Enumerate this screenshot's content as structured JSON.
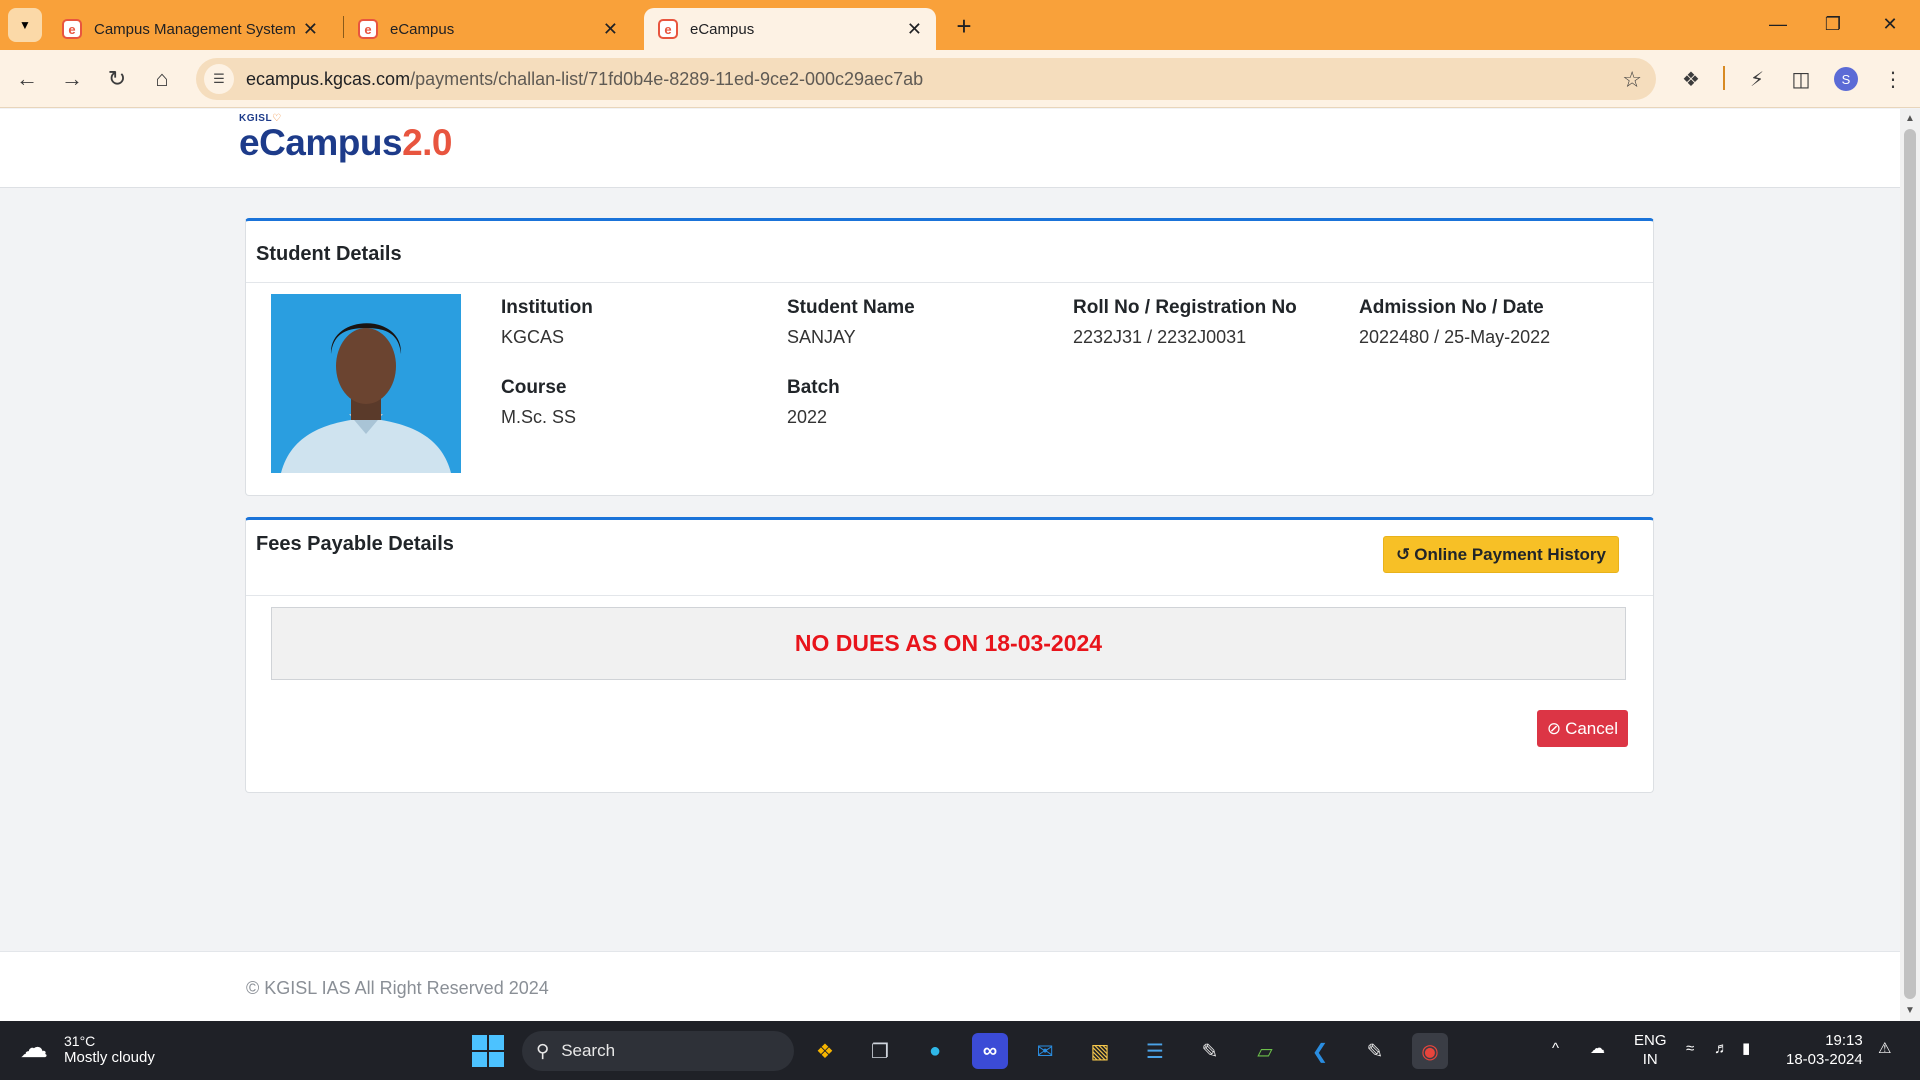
{
  "browser": {
    "tabs": [
      {
        "label": "Campus Management System",
        "active": false
      },
      {
        "label": "eCampus",
        "active": false
      },
      {
        "label": "eCampus",
        "active": true
      }
    ],
    "url_host": "ecampus.kgcas.com",
    "url_path": "/payments/challan-list/71fd0b4e-8289-11ed-9ce2-000c29aec7ab",
    "profile_initial": "S",
    "accent": "#f9a13a"
  },
  "logo": {
    "small": "KGISL",
    "main": "eCampus",
    "version": "2.0"
  },
  "student": {
    "title": "Student Details",
    "fields": [
      {
        "label": "Institution",
        "value": "KGCAS"
      },
      {
        "label": "Student Name",
        "value": "SANJAY"
      },
      {
        "label": "Roll No / Registration No",
        "value": "2232J31 / 2232J0031"
      },
      {
        "label": "Admission No / Date",
        "value": "2022480 / 25-May-2022"
      },
      {
        "label": "Course",
        "value": "M.Sc. SS"
      },
      {
        "label": "Batch",
        "value": "2022"
      }
    ]
  },
  "fees": {
    "title": "Fees Payable Details",
    "history_button": "Online Payment History",
    "no_dues": "NO DUES AS ON 18-03-2024",
    "cancel_button": "Cancel"
  },
  "footer": {
    "copyright": "© KGISL IAS All Right Reserved 2024"
  },
  "taskbar": {
    "weather_temp": "31°C",
    "weather_desc": "Mostly cloudy",
    "search_label": "Search",
    "lang_1": "ENG",
    "lang_2": "IN",
    "time": "19:13",
    "date": "18-03-2024"
  },
  "colors": {
    "card_accent": "#1a73d9",
    "no_dues_text": "#e8141b",
    "history_button": "#f7c026",
    "cancel_button": "#dc3545"
  }
}
